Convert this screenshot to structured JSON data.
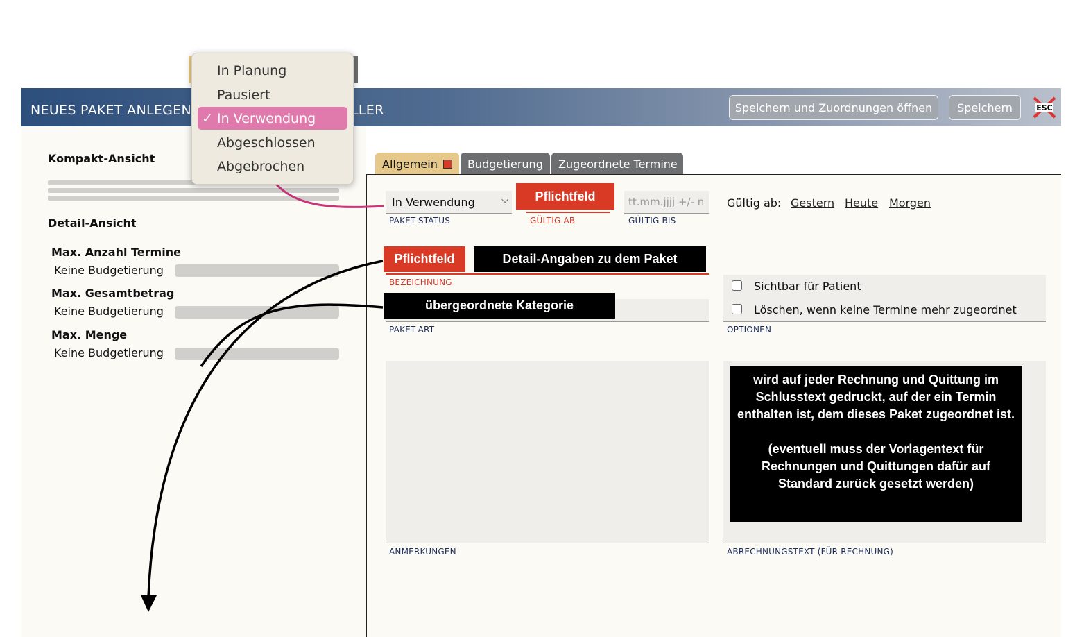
{
  "header": {
    "title": "NEUES PAKET ANLEGEN",
    "title_suffix": "LLER",
    "btn_save_open": "Speichern und Zuordnungen öffnen",
    "btn_save": "Speichern",
    "esc_label": "ESC"
  },
  "dropdown": {
    "items": [
      "In Planung",
      "Pausiert",
      "In Verwendung",
      "Abgeschlossen",
      "Abgebrochen"
    ],
    "selected": "In Verwendung",
    "checkmark": "✓"
  },
  "left": {
    "compact_title": "Kompakt-Ansicht",
    "detail_title": "Detail-Ansicht",
    "rows": [
      {
        "label": "Max. Anzahl Termine",
        "value": "Keine Budgetierung"
      },
      {
        "label": "Max. Gesamtbetrag",
        "value": "Keine Budgetierung"
      },
      {
        "label": "Max. Menge",
        "value": "Keine Budgetierung"
      }
    ]
  },
  "tabs": [
    "Allgemein",
    "Budgetierung",
    "Zugeordnete Termine"
  ],
  "form": {
    "status_value": "In Verwendung",
    "status_label": "PAKET-STATUS",
    "gueltig_ab_label": "GÜLTIG AB",
    "gueltig_bis_placeholder": "tt.mm.jjjj +/- n",
    "gueltig_bis_label": "GÜLTIG BIS",
    "gueltig_ab_text": "Gültig ab:",
    "quick_links": [
      "Gestern",
      "Heute",
      "Morgen"
    ],
    "bezeichnung_label": "BEZEICHNUNG",
    "paket_art_label": "PAKET-ART",
    "options": [
      "Sichtbar für Patient",
      "Löschen, wenn keine Termine mehr zugeordnet"
    ],
    "options_label": "OPTIONEN",
    "anmerkungen_label": "ANMERKUNGEN",
    "abrechnung_label": "ABRECHNUNGSTEXT (FÜR RECHNUNG)"
  },
  "annotations": {
    "pflichtfeld_1": "Pflichtfeld",
    "pflichtfeld_2": "Pflichtfeld",
    "detail_angaben": "Detail-Angaben zu dem Paket",
    "kategorie": "übergeordnete Kategorie",
    "abrechnung_note_1": "wird auf jeder Rechnung und Quittung im Schlusstext gedruckt, auf der ein Termin enthalten ist, dem dieses Paket zugeordnet ist.",
    "abrechnung_note_2": "(eventuell muss der Vorlagentext für Rechnungen und Quittungen dafür auf Standard zurück gesetzt werden)"
  },
  "colors": {
    "header_start": "#2d4f7c",
    "accent_red": "#d93a26",
    "tab_active": "#e6c98a",
    "tab_inactive": "#6d6e70",
    "menu_highlight": "#e07aac",
    "connector_pink": "#c8357a"
  }
}
